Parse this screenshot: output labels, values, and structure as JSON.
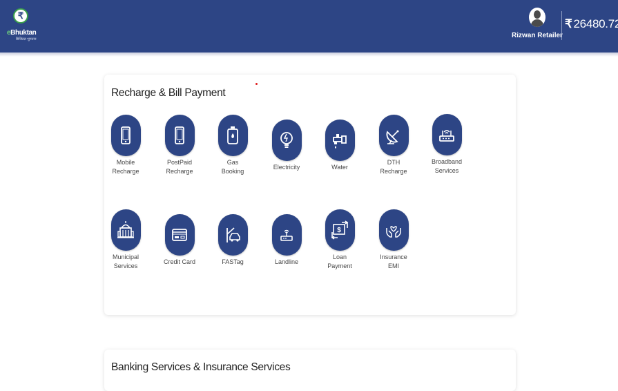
{
  "header": {
    "logo_symbol": "₹",
    "logo_dot": "e",
    "logo_name": "Bhuktan",
    "logo_tagline": "डिजिटल भुगतान",
    "user_name": "Rizwan Retailer",
    "currency_symbol": "₹",
    "balance": "26480.72",
    "colors": {
      "bar": "#2d4585",
      "accent": "#3aa04a"
    }
  },
  "recharge": {
    "title": "Recharge & Bill Payment",
    "services": [
      {
        "label": "Mobile\nRecharge",
        "icon": "mobile-icon"
      },
      {
        "label": "PostPaid\nRecharge",
        "icon": "postpaid-mobile-icon"
      },
      {
        "label": "Gas\nBooking",
        "icon": "gas-cylinder-icon"
      },
      {
        "label": "Electricity",
        "icon": "bulb-icon"
      },
      {
        "label": "Water",
        "icon": "water-tap-icon"
      },
      {
        "label": "DTH\nRecharge",
        "icon": "satellite-dish-icon"
      },
      {
        "label": "Broadband\nServices",
        "icon": "router-icon"
      },
      {
        "label": "Municipal\nServices",
        "icon": "municipal-building-icon"
      },
      {
        "label": "Credit Card",
        "icon": "credit-card-icon"
      },
      {
        "label": "FASTag",
        "icon": "fastag-car-icon"
      },
      {
        "label": "Landline",
        "icon": "landline-icon"
      },
      {
        "label": "Loan\nPayment",
        "icon": "loan-payment-icon"
      },
      {
        "label": "Insurance\nEMI",
        "icon": "insurance-hands-icon"
      }
    ]
  },
  "banking": {
    "title": "Banking Services & Insurance Services"
  }
}
